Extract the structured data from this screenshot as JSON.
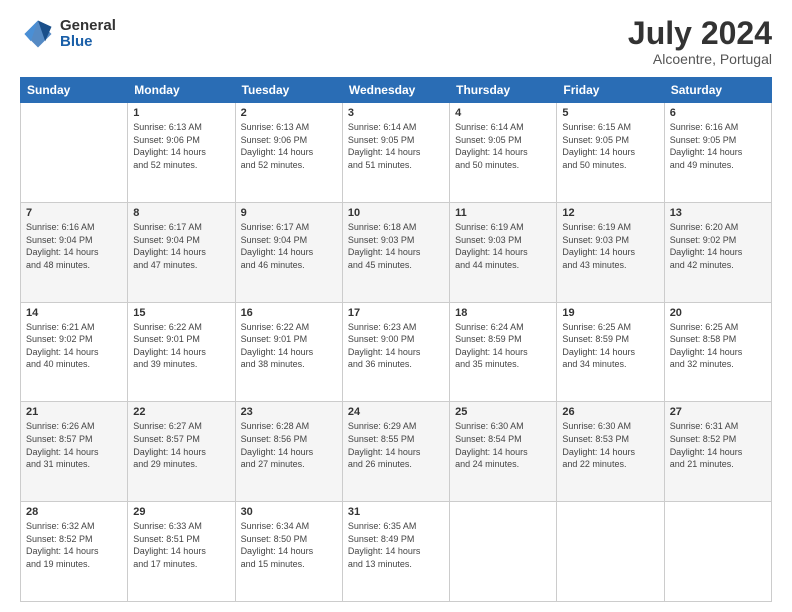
{
  "logo": {
    "general": "General",
    "blue": "Blue"
  },
  "header": {
    "month_year": "July 2024",
    "location": "Alcoentre, Portugal"
  },
  "weekdays": [
    "Sunday",
    "Monday",
    "Tuesday",
    "Wednesday",
    "Thursday",
    "Friday",
    "Saturday"
  ],
  "weeks": [
    [
      {
        "day": "",
        "sunrise": "",
        "sunset": "",
        "daylight": ""
      },
      {
        "day": "1",
        "sunrise": "Sunrise: 6:13 AM",
        "sunset": "Sunset: 9:06 PM",
        "daylight": "Daylight: 14 hours and 52 minutes."
      },
      {
        "day": "2",
        "sunrise": "Sunrise: 6:13 AM",
        "sunset": "Sunset: 9:06 PM",
        "daylight": "Daylight: 14 hours and 52 minutes."
      },
      {
        "day": "3",
        "sunrise": "Sunrise: 6:14 AM",
        "sunset": "Sunset: 9:05 PM",
        "daylight": "Daylight: 14 hours and 51 minutes."
      },
      {
        "day": "4",
        "sunrise": "Sunrise: 6:14 AM",
        "sunset": "Sunset: 9:05 PM",
        "daylight": "Daylight: 14 hours and 50 minutes."
      },
      {
        "day": "5",
        "sunrise": "Sunrise: 6:15 AM",
        "sunset": "Sunset: 9:05 PM",
        "daylight": "Daylight: 14 hours and 50 minutes."
      },
      {
        "day": "6",
        "sunrise": "Sunrise: 6:16 AM",
        "sunset": "Sunset: 9:05 PM",
        "daylight": "Daylight: 14 hours and 49 minutes."
      }
    ],
    [
      {
        "day": "7",
        "sunrise": "Sunrise: 6:16 AM",
        "sunset": "Sunset: 9:04 PM",
        "daylight": "Daylight: 14 hours and 48 minutes."
      },
      {
        "day": "8",
        "sunrise": "Sunrise: 6:17 AM",
        "sunset": "Sunset: 9:04 PM",
        "daylight": "Daylight: 14 hours and 47 minutes."
      },
      {
        "day": "9",
        "sunrise": "Sunrise: 6:17 AM",
        "sunset": "Sunset: 9:04 PM",
        "daylight": "Daylight: 14 hours and 46 minutes."
      },
      {
        "day": "10",
        "sunrise": "Sunrise: 6:18 AM",
        "sunset": "Sunset: 9:03 PM",
        "daylight": "Daylight: 14 hours and 45 minutes."
      },
      {
        "day": "11",
        "sunrise": "Sunrise: 6:19 AM",
        "sunset": "Sunset: 9:03 PM",
        "daylight": "Daylight: 14 hours and 44 minutes."
      },
      {
        "day": "12",
        "sunrise": "Sunrise: 6:19 AM",
        "sunset": "Sunset: 9:03 PM",
        "daylight": "Daylight: 14 hours and 43 minutes."
      },
      {
        "day": "13",
        "sunrise": "Sunrise: 6:20 AM",
        "sunset": "Sunset: 9:02 PM",
        "daylight": "Daylight: 14 hours and 42 minutes."
      }
    ],
    [
      {
        "day": "14",
        "sunrise": "Sunrise: 6:21 AM",
        "sunset": "Sunset: 9:02 PM",
        "daylight": "Daylight: 14 hours and 40 minutes."
      },
      {
        "day": "15",
        "sunrise": "Sunrise: 6:22 AM",
        "sunset": "Sunset: 9:01 PM",
        "daylight": "Daylight: 14 hours and 39 minutes."
      },
      {
        "day": "16",
        "sunrise": "Sunrise: 6:22 AM",
        "sunset": "Sunset: 9:01 PM",
        "daylight": "Daylight: 14 hours and 38 minutes."
      },
      {
        "day": "17",
        "sunrise": "Sunrise: 6:23 AM",
        "sunset": "Sunset: 9:00 PM",
        "daylight": "Daylight: 14 hours and 36 minutes."
      },
      {
        "day": "18",
        "sunrise": "Sunrise: 6:24 AM",
        "sunset": "Sunset: 8:59 PM",
        "daylight": "Daylight: 14 hours and 35 minutes."
      },
      {
        "day": "19",
        "sunrise": "Sunrise: 6:25 AM",
        "sunset": "Sunset: 8:59 PM",
        "daylight": "Daylight: 14 hours and 34 minutes."
      },
      {
        "day": "20",
        "sunrise": "Sunrise: 6:25 AM",
        "sunset": "Sunset: 8:58 PM",
        "daylight": "Daylight: 14 hours and 32 minutes."
      }
    ],
    [
      {
        "day": "21",
        "sunrise": "Sunrise: 6:26 AM",
        "sunset": "Sunset: 8:57 PM",
        "daylight": "Daylight: 14 hours and 31 minutes."
      },
      {
        "day": "22",
        "sunrise": "Sunrise: 6:27 AM",
        "sunset": "Sunset: 8:57 PM",
        "daylight": "Daylight: 14 hours and 29 minutes."
      },
      {
        "day": "23",
        "sunrise": "Sunrise: 6:28 AM",
        "sunset": "Sunset: 8:56 PM",
        "daylight": "Daylight: 14 hours and 27 minutes."
      },
      {
        "day": "24",
        "sunrise": "Sunrise: 6:29 AM",
        "sunset": "Sunset: 8:55 PM",
        "daylight": "Daylight: 14 hours and 26 minutes."
      },
      {
        "day": "25",
        "sunrise": "Sunrise: 6:30 AM",
        "sunset": "Sunset: 8:54 PM",
        "daylight": "Daylight: 14 hours and 24 minutes."
      },
      {
        "day": "26",
        "sunrise": "Sunrise: 6:30 AM",
        "sunset": "Sunset: 8:53 PM",
        "daylight": "Daylight: 14 hours and 22 minutes."
      },
      {
        "day": "27",
        "sunrise": "Sunrise: 6:31 AM",
        "sunset": "Sunset: 8:52 PM",
        "daylight": "Daylight: 14 hours and 21 minutes."
      }
    ],
    [
      {
        "day": "28",
        "sunrise": "Sunrise: 6:32 AM",
        "sunset": "Sunset: 8:52 PM",
        "daylight": "Daylight: 14 hours and 19 minutes."
      },
      {
        "day": "29",
        "sunrise": "Sunrise: 6:33 AM",
        "sunset": "Sunset: 8:51 PM",
        "daylight": "Daylight: 14 hours and 17 minutes."
      },
      {
        "day": "30",
        "sunrise": "Sunrise: 6:34 AM",
        "sunset": "Sunset: 8:50 PM",
        "daylight": "Daylight: 14 hours and 15 minutes."
      },
      {
        "day": "31",
        "sunrise": "Sunrise: 6:35 AM",
        "sunset": "Sunset: 8:49 PM",
        "daylight": "Daylight: 14 hours and 13 minutes."
      },
      {
        "day": "",
        "sunrise": "",
        "sunset": "",
        "daylight": ""
      },
      {
        "day": "",
        "sunrise": "",
        "sunset": "",
        "daylight": ""
      },
      {
        "day": "",
        "sunrise": "",
        "sunset": "",
        "daylight": ""
      }
    ]
  ]
}
